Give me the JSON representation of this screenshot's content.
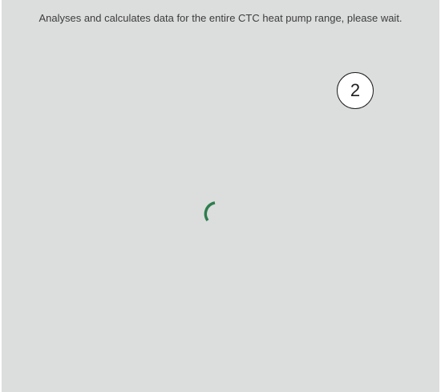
{
  "status": {
    "message": "Analyses and calculates data for the entire CTC heat pump range, please wait."
  },
  "annotation": {
    "step_number": "2"
  },
  "spinner": {
    "icon": "loading-spinner-icon",
    "color": "#2e7d4f"
  },
  "colors": {
    "panel_background": "#dcdddd",
    "text": "#3d3d3d"
  }
}
